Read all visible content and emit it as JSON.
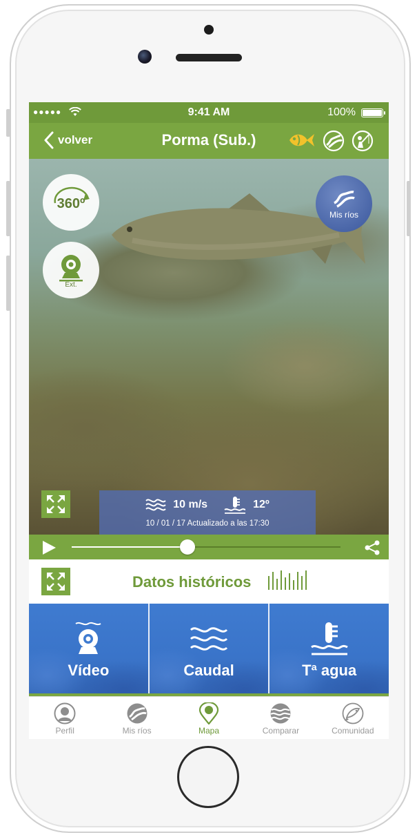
{
  "statusbar": {
    "signal": "●●●●●",
    "time": "9:41 AM",
    "battery": "100%"
  },
  "navbar": {
    "back_label": "volver",
    "title": "Porma (Sub.)"
  },
  "video": {
    "btn_360": "360º",
    "ext_label": "Ext.",
    "misrios_label": "Mis ríos",
    "speed": "10 m/s",
    "temperature": "12º",
    "updated": "10 / 01 / 17  Actualizado a las 17:30",
    "progress": 0.43
  },
  "historic": {
    "title": "Datos históricos"
  },
  "tiles": [
    {
      "label": "Vídeo"
    },
    {
      "label": "Caudal"
    },
    {
      "label": "Tª agua"
    }
  ],
  "tabbar": [
    {
      "label": "Perfil"
    },
    {
      "label": "Mis ríos"
    },
    {
      "label": "Mapa"
    },
    {
      "label": "Comparar"
    },
    {
      "label": "Comunidad"
    }
  ],
  "colors": {
    "green": "#7aa641",
    "blue": "#3f7bd0",
    "yellow": "#f2c22b"
  }
}
